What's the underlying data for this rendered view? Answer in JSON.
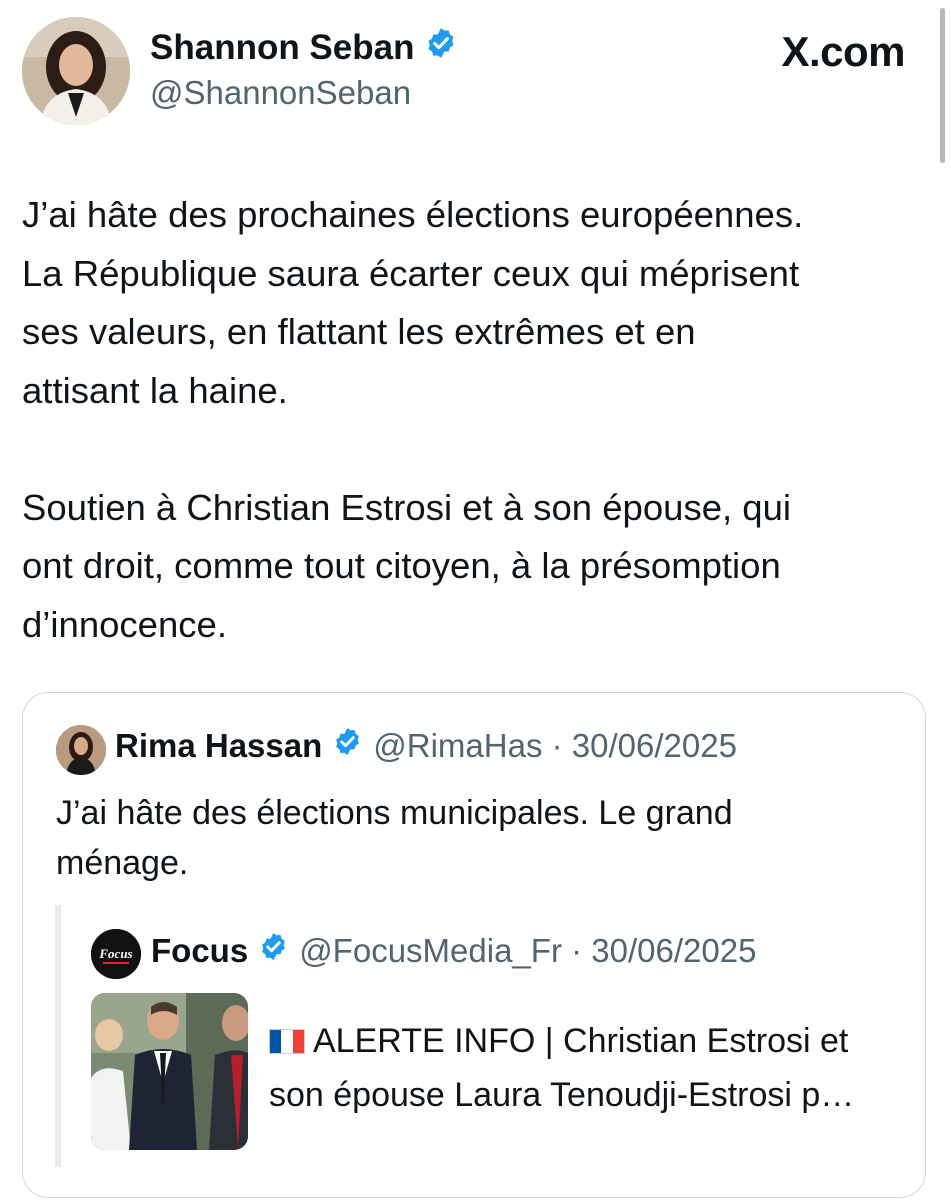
{
  "author": {
    "name": "Shannon Seban",
    "handle": "@ShannonSeban"
  },
  "brand": "X.com",
  "tweet": {
    "text": "J’ai hâte des prochaines élections européennes.\nLa République saura écarter ceux qui méprisent\nses valeurs, en flattant les extrêmes et en\nattisant la haine.\n\nSoutien à Christian Estrosi et à son épouse, qui\nont droit, comme tout citoyen, à la présomption\nd’innocence."
  },
  "quote": {
    "name": "Rima Hassan",
    "meta": "@RimaHas · 30/06/2025",
    "text": "J’ai hâte des élections municipales. Le grand\nménage."
  },
  "nested": {
    "name": "Focus",
    "logo_text": "Focus",
    "meta": "@FocusMedia_Fr · 30/06/2025",
    "text_line1": "ALERTE INFO | Christian Estrosi et",
    "text_line2": "son épouse Laura Tenoudji-Estrosi p…"
  },
  "icons": {
    "verified": "verified-badge-icon",
    "flag": "france-flag-icon"
  },
  "colors": {
    "verified": "#1d9bf0",
    "secondary_text": "#536471",
    "border": "#cfd9de"
  }
}
